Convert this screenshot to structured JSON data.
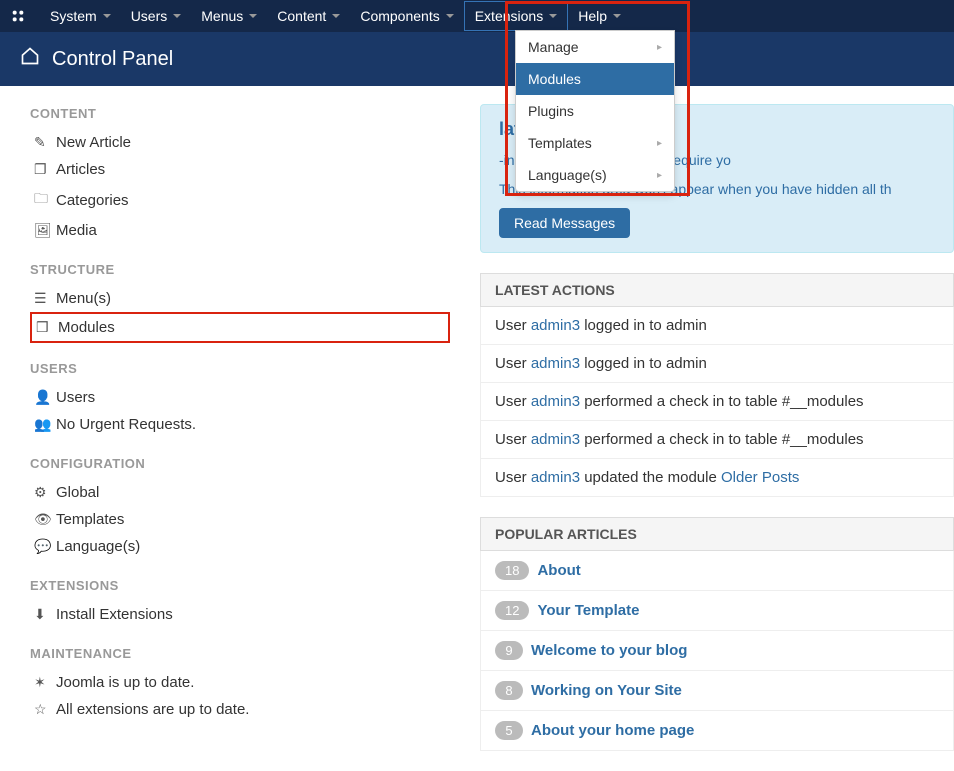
{
  "topMenu": [
    "System",
    "Users",
    "Menus",
    "Content",
    "Components",
    "Extensions",
    "Help"
  ],
  "dropdown": {
    "items": [
      {
        "label": "Manage",
        "hasSub": true
      },
      {
        "label": "Modules",
        "hasSub": false,
        "highlight": true
      },
      {
        "label": "Plugins",
        "hasSub": false
      },
      {
        "label": "Templates",
        "hasSub": true
      },
      {
        "label": "Language(s)",
        "hasSub": true
      }
    ]
  },
  "pageTitle": "Control Panel",
  "sidebar": {
    "content": {
      "title": "CONTENT",
      "items": [
        "New Article",
        "Articles",
        "Categories",
        "Media"
      ]
    },
    "structure": {
      "title": "STRUCTURE",
      "items": [
        "Menu(s)",
        "Modules"
      ]
    },
    "users": {
      "title": "USERS",
      "items": [
        "Users",
        "No Urgent Requests."
      ]
    },
    "configuration": {
      "title": "CONFIGURATION",
      "items": [
        "Global",
        "Templates",
        "Language(s)"
      ]
    },
    "extensions": {
      "title": "EXTENSIONS",
      "items": [
        "Install Extensions"
      ]
    },
    "maintenance": {
      "title": "MAINTENANCE",
      "items": [
        "Joomla is up to date.",
        "All extensions are up to date."
      ]
    }
  },
  "infoBox": {
    "title": "lation messages",
    "line1": "-installation messages that require yo",
    "line2": "This information area won't appear when you have hidden all th",
    "button": "Read Messages"
  },
  "latestActions": {
    "title": "LATEST ACTIONS",
    "rows": [
      {
        "pre": "User ",
        "user": "admin3",
        "post": " logged in to admin"
      },
      {
        "pre": "User ",
        "user": "admin3",
        "post": " logged in to admin"
      },
      {
        "pre": "User ",
        "user": "admin3",
        "post": " performed a check in to table #__modules"
      },
      {
        "pre": "User ",
        "user": "admin3",
        "post": " performed a check in to table #__modules"
      },
      {
        "pre": "User ",
        "user": "admin3",
        "post": " updated the module ",
        "link": "Older Posts"
      }
    ]
  },
  "popular": {
    "title": "POPULAR ARTICLES",
    "rows": [
      {
        "count": "18",
        "title": "About"
      },
      {
        "count": "12",
        "title": "Your Template"
      },
      {
        "count": "9",
        "title": "Welcome to your blog"
      },
      {
        "count": "8",
        "title": "Working on Your Site"
      },
      {
        "count": "5",
        "title": "About your home page"
      }
    ]
  }
}
